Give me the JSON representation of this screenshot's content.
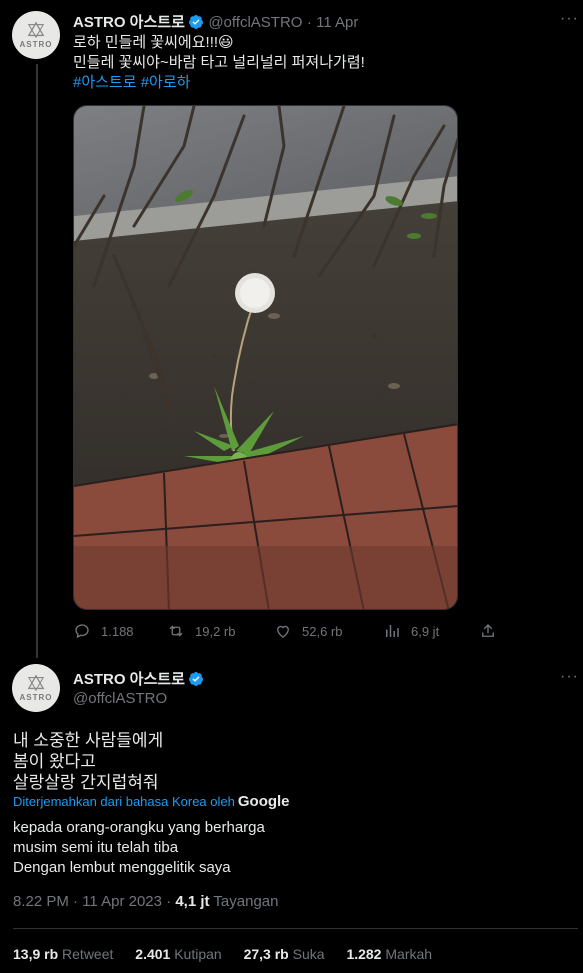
{
  "tweet1": {
    "author_name": "ASTRO 아스트로",
    "handle": "@offclASTRO",
    "date": "· 11 Apr",
    "lines": [
      "로하 민들레 꽃씨에요!!!😃",
      "민들레 꽃씨야~바람 타고 널리널리 퍼져나가렴!"
    ],
    "hashtags": "#아스트로 #아로하",
    "actions": {
      "replies": "1.188",
      "retweets": "19,2 rb",
      "likes": "52,6 rb",
      "views": "6,9 jt"
    }
  },
  "tweet2": {
    "author_name": "ASTRO 아스트로",
    "handle": "@offclASTRO",
    "original_lines": [
      "내 소중한 사람들에게",
      "봄이 왔다고",
      "살랑살랑 간지럽혀줘"
    ],
    "translated_note": "Diterjemahkan dari bahasa Korea oleh",
    "translator": "Google",
    "translated_lines": [
      "kepada orang-orangku yang berharga",
      "musim semi itu telah tiba",
      "Dengan lembut menggelitik saya"
    ],
    "timestamp": "8.22 PM · 11 Apr 2023 ·",
    "views_count": "4,1 jt",
    "views_label": "Tayangan",
    "stats": [
      {
        "value": "13,9 rb",
        "label": "Retweet"
      },
      {
        "value": "2.401",
        "label": "Kutipan"
      },
      {
        "value": "27,3 rb",
        "label": "Suka"
      },
      {
        "value": "1.282",
        "label": "Markah"
      }
    ]
  },
  "avatar_text": "ASTRO",
  "more_glyph": "···",
  "colors": {
    "background": "#000000",
    "accent": "#1d9bf0",
    "muted": "#71767b",
    "text": "#e7e9ea"
  }
}
